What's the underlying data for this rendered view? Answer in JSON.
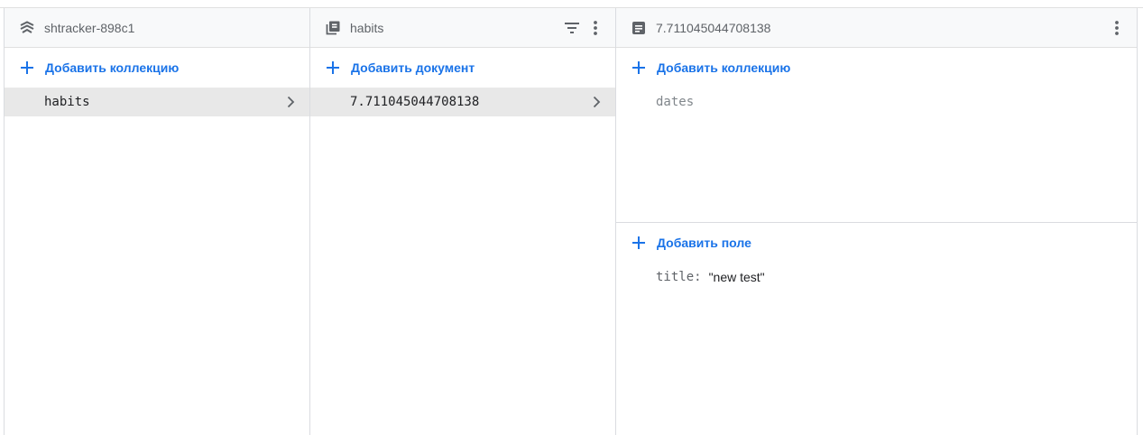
{
  "colors": {
    "accent": "#1a73e8",
    "header_bg": "#f8f9fa",
    "selected_bg": "#e8e8e8",
    "border": "#dadce0"
  },
  "root_panel": {
    "header_icon": "firestore-database-icon",
    "title": "shtracker-898c1",
    "add_label": "Добавить коллекцию",
    "items": [
      {
        "label": "habits",
        "selected": true
      }
    ]
  },
  "collection_panel": {
    "header_icon": "collection-icon",
    "title": "habits",
    "actions": [
      "filter-icon",
      "more-vert-icon"
    ],
    "add_label": "Добавить документ",
    "items": [
      {
        "label": "7.711045044708138",
        "selected": true
      }
    ]
  },
  "document_panel": {
    "header_icon": "document-icon",
    "title": "7.711045044708138",
    "actions": [
      "more-vert-icon"
    ],
    "add_collection_label": "Добавить коллекцию",
    "subcollections": [
      "dates"
    ],
    "add_field_label": "Добавить поле",
    "fields": [
      {
        "key": "title:",
        "value": "\"new test\""
      }
    ]
  }
}
